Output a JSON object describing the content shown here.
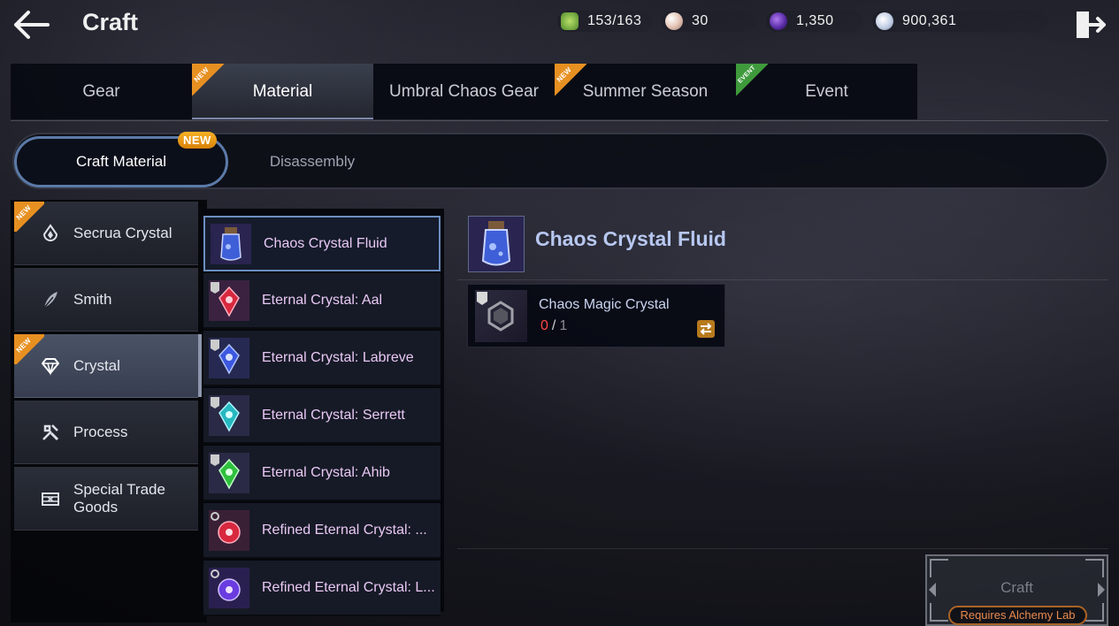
{
  "header": {
    "title": "Craft",
    "currencies": [
      {
        "icon": "stamina-icon",
        "value": "153/163",
        "color": "#6fae3a"
      },
      {
        "icon": "pearl-icon",
        "value": "30",
        "color": "#e7c7b8"
      },
      {
        "icon": "dark-orb-icon",
        "value": "1,350",
        "color": "#5a2ea8"
      },
      {
        "icon": "silver-coin-icon",
        "value": "900,361",
        "color": "#c8d4e8"
      }
    ]
  },
  "main_tabs": [
    {
      "label": "Gear",
      "tag": ""
    },
    {
      "label": "Material",
      "tag": "NEW",
      "tag_color": "#e79022"
    },
    {
      "label": "Umbral Chaos Gear",
      "tag": ""
    },
    {
      "label": "Summer Season",
      "tag": "NEW",
      "tag_color": "#e79022"
    },
    {
      "label": "Event",
      "tag": "EVENT",
      "tag_color": "#3f9a3c"
    }
  ],
  "sub_tabs": [
    {
      "label": "Craft Material",
      "badge": "NEW"
    },
    {
      "label": "Disassembly"
    }
  ],
  "categories": [
    {
      "label": "Secrua Crystal",
      "icon": "crystal-drop-icon",
      "tag": "NEW"
    },
    {
      "label": "Smith",
      "icon": "feather-icon",
      "tag": ""
    },
    {
      "label": "Crystal",
      "icon": "diamond-icon",
      "tag": "NEW"
    },
    {
      "label": "Process",
      "icon": "tools-icon",
      "tag": ""
    },
    {
      "label": "Special Trade Goods",
      "icon": "crate-icon",
      "tag": ""
    }
  ],
  "items": [
    {
      "label": "Chaos Crystal Fluid",
      "gem_color": "#3f5fd8"
    },
    {
      "label": "Eternal Crystal: Aal",
      "gem_color": "#d8283e"
    },
    {
      "label": "Eternal Crystal: Labreve",
      "gem_color": "#3c58e0"
    },
    {
      "label": "Eternal Crystal: Serrett",
      "gem_color": "#26b8c0"
    },
    {
      "label": "Eternal Crystal: Ahib",
      "gem_color": "#2fbf3d"
    },
    {
      "label": "Refined Eternal Crystal: ...",
      "gem_color": "#d8283e"
    },
    {
      "label": "Refined Eternal Crystal: L...",
      "gem_color": "#6a3ce0"
    }
  ],
  "detail": {
    "title": "Chaos Crystal Fluid",
    "material": {
      "name": "Chaos Magic Crystal",
      "have": "0",
      "sep": "/",
      "need": "1"
    },
    "craft_label": "Craft",
    "requirement": "Requires Alchemy Lab"
  }
}
